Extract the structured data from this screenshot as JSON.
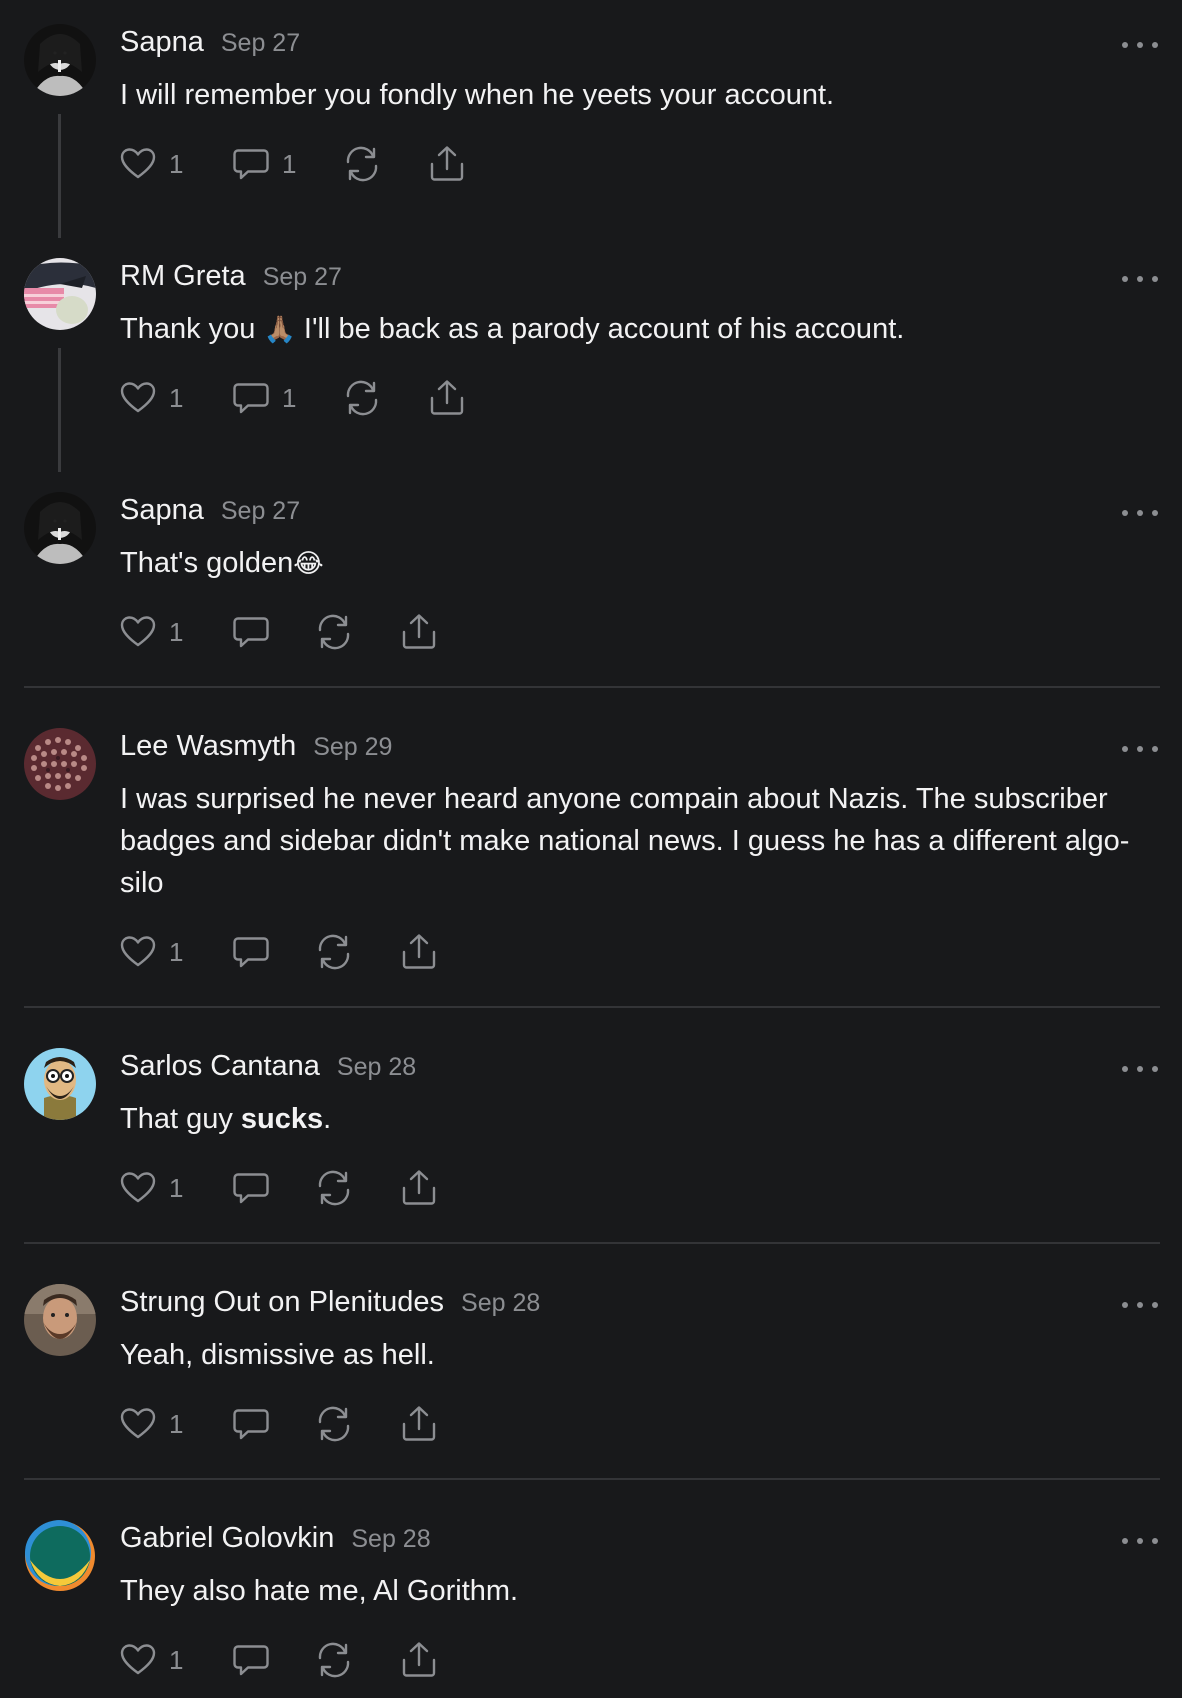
{
  "comments": [
    {
      "author": "Sapna",
      "date": "Sep 27",
      "text": "I will remember you fondly when he yeets your account.",
      "likes": "1",
      "replies": "1"
    },
    {
      "author": "RM Greta",
      "date": "Sep 27",
      "text_before": "Thank you ",
      "emoji": "🙏🏽",
      "text_after": " I'll be back as a parody account of his account.",
      "likes": "1",
      "replies": "1"
    },
    {
      "author": "Sapna",
      "date": "Sep 27",
      "text": "That's golden",
      "emoji": "😂",
      "likes": "1",
      "replies": ""
    },
    {
      "author": "Lee Wasmyth",
      "date": "Sep 29",
      "text": "I was surprised he never heard anyone compain about Nazis. The subscriber badges and sidebar didn't make national news. I guess he has a different algo-silo",
      "likes": "1",
      "replies": ""
    },
    {
      "author": "Sarlos Cantana",
      "date": "Sep 28",
      "text_before": "That guy ",
      "text_bold": "sucks",
      "text_after": ".",
      "likes": "1",
      "replies": ""
    },
    {
      "author": "Strung Out on Plenitudes",
      "date": "Sep 28",
      "text": "Yeah, dismissive as hell.",
      "likes": "1",
      "replies": ""
    },
    {
      "author": "Gabriel Golovkin",
      "date": "Sep 28",
      "text": "They also hate me, Al Gorithm.",
      "likes": "1",
      "replies": ""
    }
  ],
  "icons": {
    "like": "heart-icon",
    "reply": "comment-bubble-icon",
    "restack": "restack-icon",
    "share": "share-icon",
    "more": "more-dots-icon"
  },
  "colors": {
    "background": "#18191b",
    "text": "#f2f2f3",
    "muted": "#8c8e92",
    "divider": "#333437"
  }
}
